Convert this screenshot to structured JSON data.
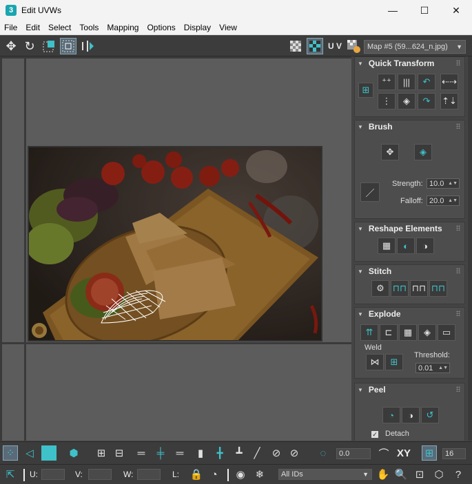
{
  "window": {
    "title": "Edit UVWs",
    "app_icon_label": "3",
    "controls": {
      "minimize": "—",
      "maximize": "☐",
      "close": "✕"
    }
  },
  "menu": [
    "File",
    "Edit",
    "Select",
    "Tools",
    "Mapping",
    "Options",
    "Display",
    "View"
  ],
  "toolbar": {
    "uv_label": "U V",
    "map_select": "Map #5 (59...624_n.jpg)"
  },
  "panel": {
    "quick_transform": {
      "title": "Quick Transform"
    },
    "brush": {
      "title": "Brush",
      "strength_label": "Strength:",
      "strength_value": "10.0",
      "falloff_label": "Falloff:",
      "falloff_value": "20.0"
    },
    "reshape": {
      "title": "Reshape Elements"
    },
    "stitch": {
      "title": "Stitch"
    },
    "explode": {
      "title": "Explode",
      "weld_label": "Weld",
      "threshold_label": "Threshold:",
      "threshold_value": "0.01"
    },
    "peel": {
      "title": "Peel",
      "detach_label": "Detach",
      "detach_checked": true
    }
  },
  "bottom": {
    "rotation_value": "0.0",
    "xy_label": "XY",
    "grid_value": "16",
    "u_label": "U:",
    "v_label": "V:",
    "w_label": "W:",
    "l_label": "L:",
    "u_value": "",
    "v_value": "",
    "w_value": "",
    "ids_select": "All IDs"
  },
  "colors": {
    "accent": "#3fc1c9",
    "panel_bg": "#444444",
    "viewport_bg": "#5c5c5c"
  }
}
